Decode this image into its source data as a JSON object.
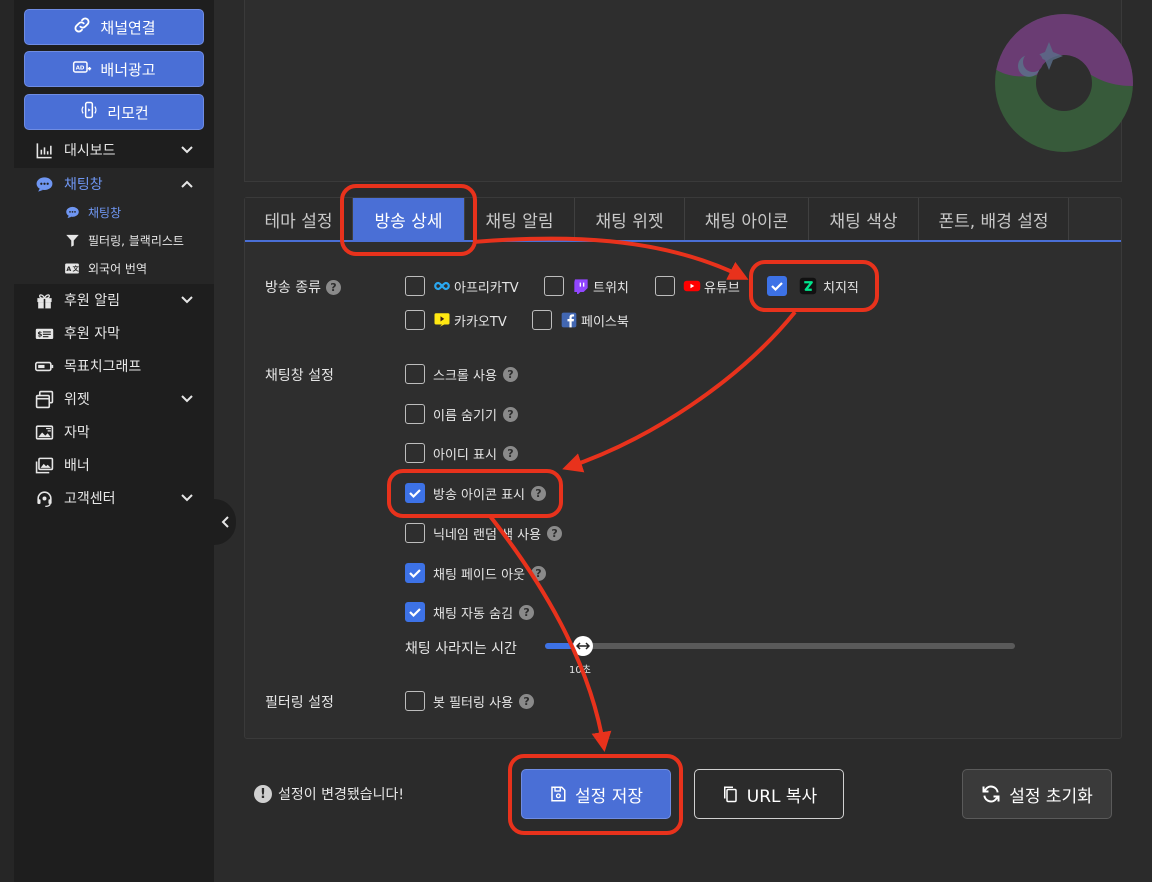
{
  "sidebar": {
    "top_buttons": [
      {
        "label": "채널연결",
        "icon": "link-icon"
      },
      {
        "label": "배너광고",
        "icon": "ad-icon"
      },
      {
        "label": "리모컨",
        "icon": "remote-icon"
      }
    ],
    "items": [
      {
        "label": "대시보드",
        "icon": "chart-icon"
      },
      {
        "label": "채팅창",
        "icon": "chat-icon"
      },
      {
        "label": "후원 알림",
        "icon": "gift-icon"
      },
      {
        "label": "후원 자막",
        "icon": "money-icon"
      },
      {
        "label": "목표치그래프",
        "icon": "battery-icon"
      },
      {
        "label": "위젯",
        "icon": "windows-icon"
      },
      {
        "label": "자막",
        "icon": "caption-icon"
      },
      {
        "label": "배너",
        "icon": "image-icon"
      },
      {
        "label": "고객센터",
        "icon": "headset-icon"
      }
    ],
    "sub_items": [
      {
        "label": "채팅창",
        "icon": "chat-icon"
      },
      {
        "label": "필터링, 블랙리스트",
        "icon": "filter-icon"
      },
      {
        "label": "외국어 번역",
        "icon": "translate-icon"
      }
    ]
  },
  "tabs": [
    "테마 설정",
    "방송 상세",
    "채팅 알림",
    "채팅 위젯",
    "채팅 아이콘",
    "채팅 색상",
    "폰트, 배경 설정"
  ],
  "sections": {
    "broadcast_type": {
      "label": "방송 종류",
      "options": [
        {
          "label": "아프리카TV",
          "checked": false,
          "icon": "afreecatv-icon"
        },
        {
          "label": "트위치",
          "checked": false,
          "icon": "twitch-icon"
        },
        {
          "label": "유튜브",
          "checked": false,
          "icon": "youtube-icon"
        },
        {
          "label": "치지직",
          "checked": true,
          "icon": "chzzk-icon"
        },
        {
          "label": "카카오TV",
          "checked": false,
          "icon": "kakaotv-icon"
        },
        {
          "label": "페이스북",
          "checked": false,
          "icon": "facebook-icon"
        }
      ]
    },
    "chat_settings": {
      "label": "채팅창 설정",
      "options": [
        {
          "label": "스크롤 사용",
          "checked": false
        },
        {
          "label": "이름 숨기기",
          "checked": false
        },
        {
          "label": "아이디 표시",
          "checked": false
        },
        {
          "label": "방송 아이콘 표시",
          "checked": true
        },
        {
          "label": "닉네임 랜덤 색 사용",
          "checked": false
        },
        {
          "label": "채팅 페이드 아웃",
          "checked": true
        },
        {
          "label": "채팅 자동 숨김",
          "checked": true
        }
      ],
      "slider": {
        "label": "채팅 사라지는 시간",
        "value_text": "10초",
        "fraction": 0.08
      }
    },
    "filtering": {
      "label": "필터링 설정",
      "options": [
        {
          "label": "봇 필터링 사용",
          "checked": false
        }
      ]
    }
  },
  "footer": {
    "notice": "설정이 변경됐습니다!",
    "save_label": "설정 저장",
    "url_label": "URL 복사",
    "reset_label": "설정 초기화"
  },
  "colors": {
    "accent": "#4a6fd6",
    "checkbox": "#3d72e6",
    "annotation": "#e8321c",
    "chzzk": "#00e58c"
  }
}
